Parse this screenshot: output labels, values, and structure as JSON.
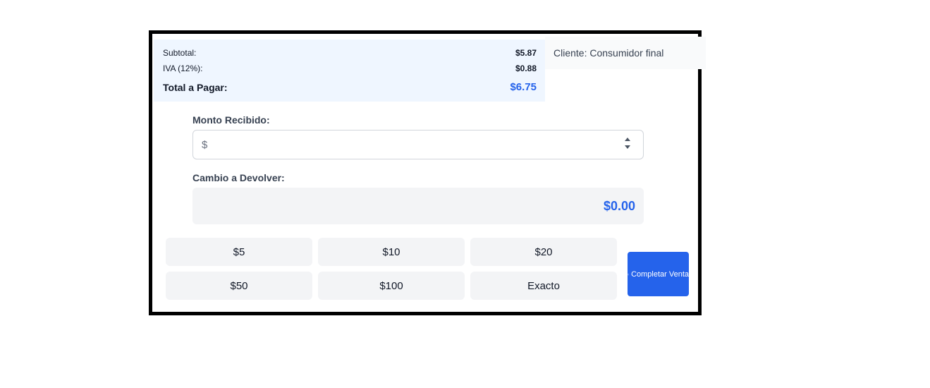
{
  "summary": {
    "subtotal_label": "Subtotal:",
    "subtotal_value": "$5.87",
    "iva_label": "IVA (12%):",
    "iva_value": "$0.88",
    "total_label": "Total a Pagar:",
    "total_value": "$6.75"
  },
  "client": {
    "text": "Cliente: Consumidor final"
  },
  "payment": {
    "received_label": "Monto Recibido:",
    "received_prefix": "$",
    "received_value": "",
    "change_label": "Cambio a Devolver:",
    "change_value": "$0.00"
  },
  "quick_amounts": [
    "$5",
    "$10",
    "$20",
    "$50",
    "$100",
    "Exacto"
  ],
  "actions": {
    "complete_label": "Completar Venta"
  },
  "icons": {
    "complete": "check-circle-icon",
    "spinner": "number-spinner-icon"
  },
  "colors": {
    "accent": "#2563eb",
    "summary_bg": "#eff6ff",
    "button_bg": "#f3f4f6"
  }
}
